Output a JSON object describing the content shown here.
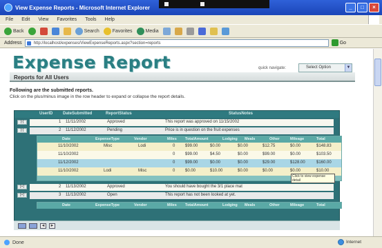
{
  "window": {
    "title": "View Expense Reports - Microsoft Internet Explorer",
    "buttons": {
      "minimize": "_",
      "maximize": "□",
      "close": "×"
    }
  },
  "menu": [
    "File",
    "Edit",
    "View",
    "Favorites",
    "Tools",
    "Help"
  ],
  "toolbar": {
    "back": "Back",
    "search": "Search",
    "favorites": "Favorites",
    "media": "Media"
  },
  "address": {
    "label": "Address",
    "url": "http://localhost/expenses/ViewExpenseReports.aspx?section=reports",
    "go": "Go"
  },
  "page": {
    "title": "Expense Report",
    "subtitle": "Reports for All Users",
    "quick_nav_label": "quick navigate:",
    "select_value": "Select Option",
    "intro_bold": "Following are the submitted reports.",
    "intro_rest": "Click on the plus/minus image in the row header to expand or collapse the report details."
  },
  "grid": {
    "columns": [
      "UserID",
      "DateSubmitted",
      "ReportStatus",
      "StatusNotes"
    ],
    "rows": [
      {
        "expander": "[-]",
        "user": "1",
        "date": "11/11/2002",
        "status": "Approved",
        "notes": "This report was approved on 11/15/2002"
      },
      {
        "expander": "[-]",
        "user": "2",
        "date": "11/12/2002",
        "status": "Pending",
        "notes": "Price is in question on the fruit expenses"
      },
      {
        "expander": "[+]",
        "user": "2",
        "date": "11/13/2002",
        "status": "Approved",
        "notes": "You should have bought the 3/1 place mat"
      },
      {
        "expander": "[+]",
        "user": "3",
        "date": "11/13/2002",
        "status": "Open",
        "notes": "This report has not been looked at yet."
      }
    ],
    "detail_columns": [
      "Date",
      "ExpenseType",
      "Vendor",
      "Miles",
      "TotalAmount",
      "Lodging",
      "Meals",
      "Other",
      "Mileage",
      "Total"
    ],
    "detail_rows": [
      {
        "date": "11/10/2002",
        "type": "Misc",
        "vendor": "Lodi",
        "miles": "0",
        "amount": "$99.00",
        "lodging": "$0.00",
        "meals": "$0.00",
        "other": "$12.75",
        "mileage": "$0.00",
        "total": "$148.83"
      },
      {
        "date": "11/10/2002",
        "type": "",
        "vendor": "",
        "miles": "0",
        "amount": "$99.00",
        "lodging": "$4.50",
        "meals": "$0.00",
        "other": "$99.00",
        "mileage": "$0.00",
        "total": "$103.50"
      },
      {
        "date": "11/12/2002",
        "type": "",
        "vendor": "",
        "miles": "0",
        "amount": "$99.00",
        "lodging": "$0.00",
        "meals": "$0.00",
        "other": "$29.00",
        "mileage": "$128.00",
        "total": "$160.00"
      },
      {
        "date": "11/10/2002",
        "type": "Lodi",
        "vendor": "Misc",
        "miles": "0",
        "amount": "$0.00",
        "lodging": "$10.00",
        "meals": "$0.00",
        "other": "$0.00",
        "mileage": "$0.00",
        "total": "$10.00"
      }
    ],
    "tooltip": "Click to view expense detail",
    "detail_header_2": [
      "Date",
      "ExpenseType",
      "Vendor",
      "Miles",
      "TotalAmount",
      "Lodging",
      "Meals",
      "Other",
      "Mileage",
      "Total"
    ]
  },
  "pager": {
    "prev": "◄",
    "next": "►"
  },
  "status": {
    "left": "Done",
    "zone": "Internet"
  }
}
